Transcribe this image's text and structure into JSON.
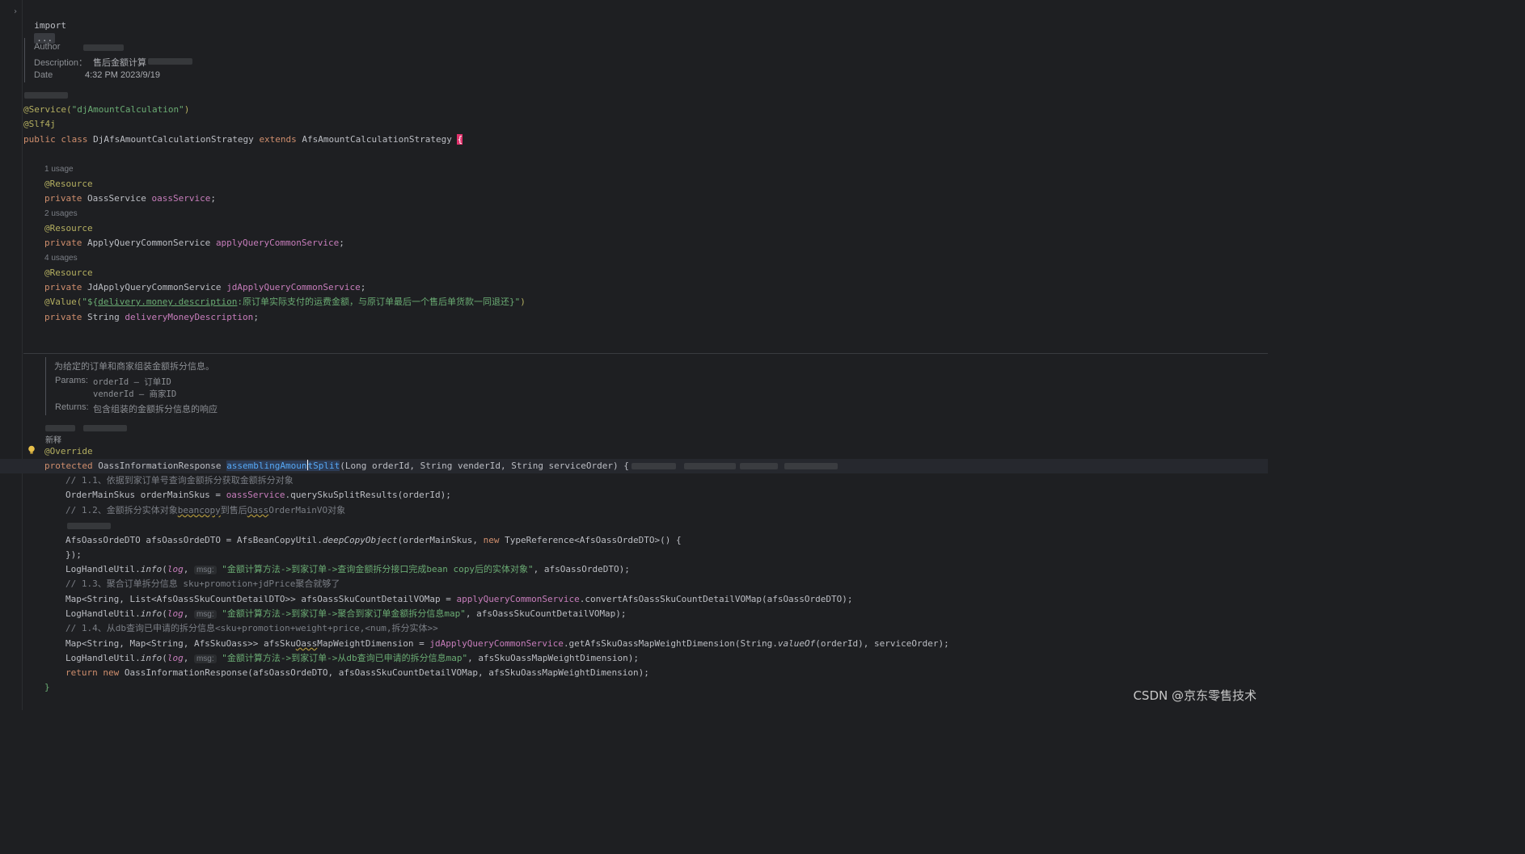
{
  "header": {
    "import_kw": "import",
    "import_dots": "...",
    "author_label": "Author",
    "description_label": "Description：",
    "description_value": "售后金额计算",
    "date_label": "Date",
    "date_value": "4:32 PM 2023/9/19"
  },
  "class_decl": {
    "service_ann": "@Service(",
    "service_arg": "\"djAmountCalculation\"",
    "service_close": ")",
    "slf4j": "@Slf4j",
    "public_kw": "public",
    "class_kw": "class",
    "class_name": "DjAfsAmountCalculationStrategy",
    "extends_kw": "extends",
    "parent_name": "AfsAmountCalculationStrategy",
    "open_brace": "{"
  },
  "fields": {
    "usage1": "1 usage",
    "usage2": "2 usages",
    "usage3": "4 usages",
    "resource": "@Resource",
    "private_kw": "private",
    "f1_type": "OassService",
    "f1_name": "oassService",
    "f2_type": "ApplyQueryCommonService",
    "f2_name": "applyQueryCommonService",
    "f3_type": "JdApplyQueryCommonService",
    "f3_name": "jdApplyQueryCommonService",
    "value_ann": "@Value(",
    "value_str_start": "\"${",
    "value_key": "delivery.money.description",
    "value_str_rest": ":原订单实际支付的运费金额，与原订单最后一个售后单货款一同退还}\"",
    "value_close": ")",
    "f4_type": "String",
    "f4_name": "deliveryMoneyDescription",
    "semicolon": ";"
  },
  "javadoc": {
    "summary": "为给定的订单和商家组装金额拆分信息。",
    "params_label": "Params:",
    "param1": "orderId – 订单ID",
    "param2": "venderId – 商家ID",
    "returns_label": "Returns:",
    "returns_value": "包含组装的金额拆分信息的响应",
    "note_label": "新释"
  },
  "method": {
    "override": "@Override",
    "protected_kw": "protected",
    "return_type": "OassInformationResponse",
    "name_a": "assemblingAmoun",
    "name_b": "tSplit",
    "params": "(Long orderId, String venderId, String serviceOrder)",
    "open": " {",
    "c1": "// 1.1、依据到家订单号查询金额拆分获取金额拆分对象",
    "l1_a": "OrderMainSkus orderMainSkus = ",
    "l1_fld": "oassService",
    "l1_b": ".querySkuSplitResults(orderId);",
    "c2_a": "// 1.2、金额拆分实体对象",
    "c2_u1": "beancopy",
    "c2_b": "到售后",
    "c2_u2": "Oass",
    "c2_c": "OrderMainVO对象",
    "l2_a": "AfsOassOrdeDTO afsOassOrdeDTO = AfsBeanCopyUtil.",
    "l2_it": "deepCopyObject",
    "l2_b": "(orderMainSkus, ",
    "l2_new": "new",
    "l2_c": " TypeReference<AfsOassOrdeDTO>() {",
    "l3": "});",
    "log_a": "LogHandleUtil.",
    "log_info": "info",
    "log_open": "(",
    "log_var": "log",
    "log_comma": ", ",
    "msg_hint": "msg:",
    "log1_str": "\"金额计算方法->到家订单->查询金额拆分接口完成bean copy后的实体对象\"",
    "log1_rest": ", afsOassOrdeDTO);",
    "c3": "// 1.3、聚合订单拆分信息 sku+promotion+jdPrice聚合就够了",
    "l4_a": "Map<String, List<AfsOassSkuCountDetailDTO>> afsOassSkuCountDetailVOMap = ",
    "l4_fld": "applyQueryCommonService",
    "l4_b": ".convertAfsOassSkuCountDetailVOMap(afsOassOrdeDTO);",
    "log2_str": "\"金额计算方法->到家订单->聚合到家订单金额拆分信息map\"",
    "log2_rest": ", afsOassSkuCountDetailVOMap);",
    "c4": "// 1.4、从db查询已申请的拆分信息<sku+promotion+weight+price,<num,拆分实体>>",
    "l5_a": "Map<String, Map<String, AfsSkuOass>> afsSku",
    "l5_u": "Oass",
    "l5_b": "MapWeightDimension = ",
    "l5_fld": "jdApplyQueryCommonService",
    "l5_c": ".getAfsSkuOassMapWeightDimension(String.",
    "l5_it": "valueOf",
    "l5_d": "(orderId), serviceOrder);",
    "log3_str": "\"金额计算方法->到家订单->从db查询已申请的拆分信息map\"",
    "log3_rest": ", afsSkuOassMapWeightDimension);",
    "ret_kw": "return",
    "ret_new": "new",
    "ret_rest": " OassInformationResponse(afsOassOrdeDTO, afsOassSkuCountDetailVOMap, afsSkuOassMapWeightDimension);",
    "close": "}"
  },
  "watermark": "CSDN @京东零售技术",
  "colors": {
    "background": "#1e1f22",
    "keyword": "#cf8e6d",
    "annotation": "#b3ae60",
    "string": "#6aab73",
    "field": "#c77dbb",
    "comment": "#7a7e85",
    "method": "#56a8f5"
  }
}
